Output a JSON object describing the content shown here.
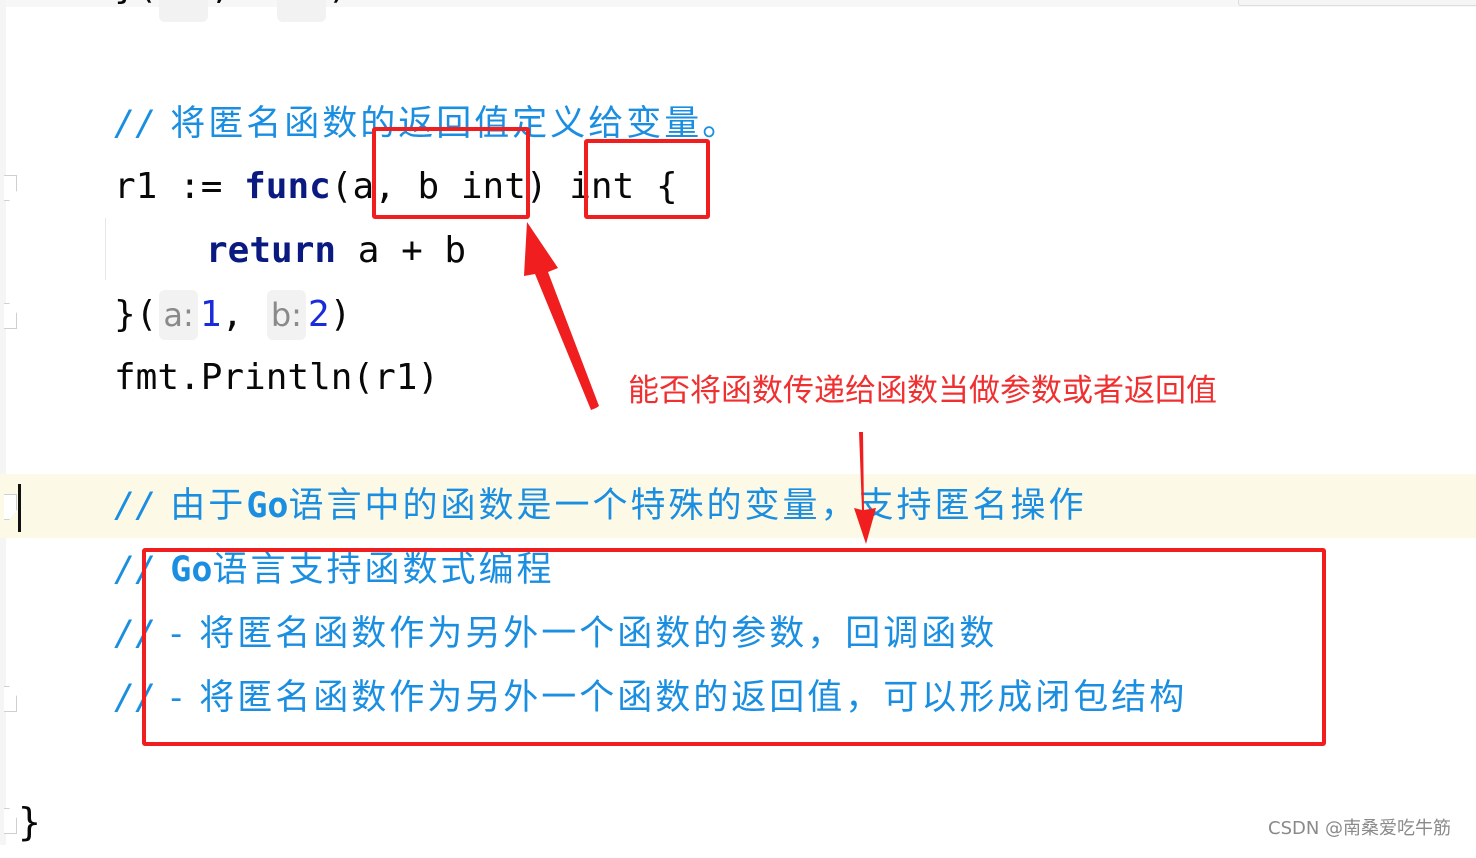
{
  "editor": {
    "language": "go",
    "partial_top_line": {
      "prefix": "}(",
      "sep": ",",
      "suffix": ")"
    },
    "lines": [
      {
        "comment": "将匿名函数的返回值定义给变量。"
      },
      {
        "var": "r1",
        "op": ":=",
        "kw_func": "func",
        "params": "(a, b int)",
        "ret": "int",
        "brace": "{"
      },
      {
        "kw_return": "return",
        "expr": "a + b"
      },
      {
        "close": "}(",
        "hint_a": "a:",
        "val_a": "1",
        "comma": ",",
        "hint_b": "b:",
        "val_b": "2",
        "end": ")"
      },
      {
        "code": "fmt.Println(r1)"
      },
      {
        "slash": "//",
        "pre": "由于",
        "latin": "Go",
        "post": "语言中的函数是一个特殊的变量，支持匿名操作"
      },
      {
        "slash": "//",
        "latin": "Go",
        "post": "语言支持函数式编程"
      },
      {
        "slash": "//",
        "post": "- 将匿名函数作为另外一个函数的参数，回调函数"
      },
      {
        "slash": "//",
        "post": "- 将匿名函数作为另外一个函数的返回值，可以形成闭包结构"
      }
    ],
    "comment_slash": "//",
    "final_brace": "}"
  },
  "annotation": {
    "text": "能否将函数传递给函数当做参数或者返回值",
    "color": "#f03030"
  },
  "colors": {
    "comment": "#1a8ee0",
    "keyword": "#0b1a80",
    "number": "#1a2bd9",
    "highlight_line": "#fdf9e7",
    "box": "#f01e1e"
  },
  "watermark": "CSDN @南桑爱吃牛筋"
}
